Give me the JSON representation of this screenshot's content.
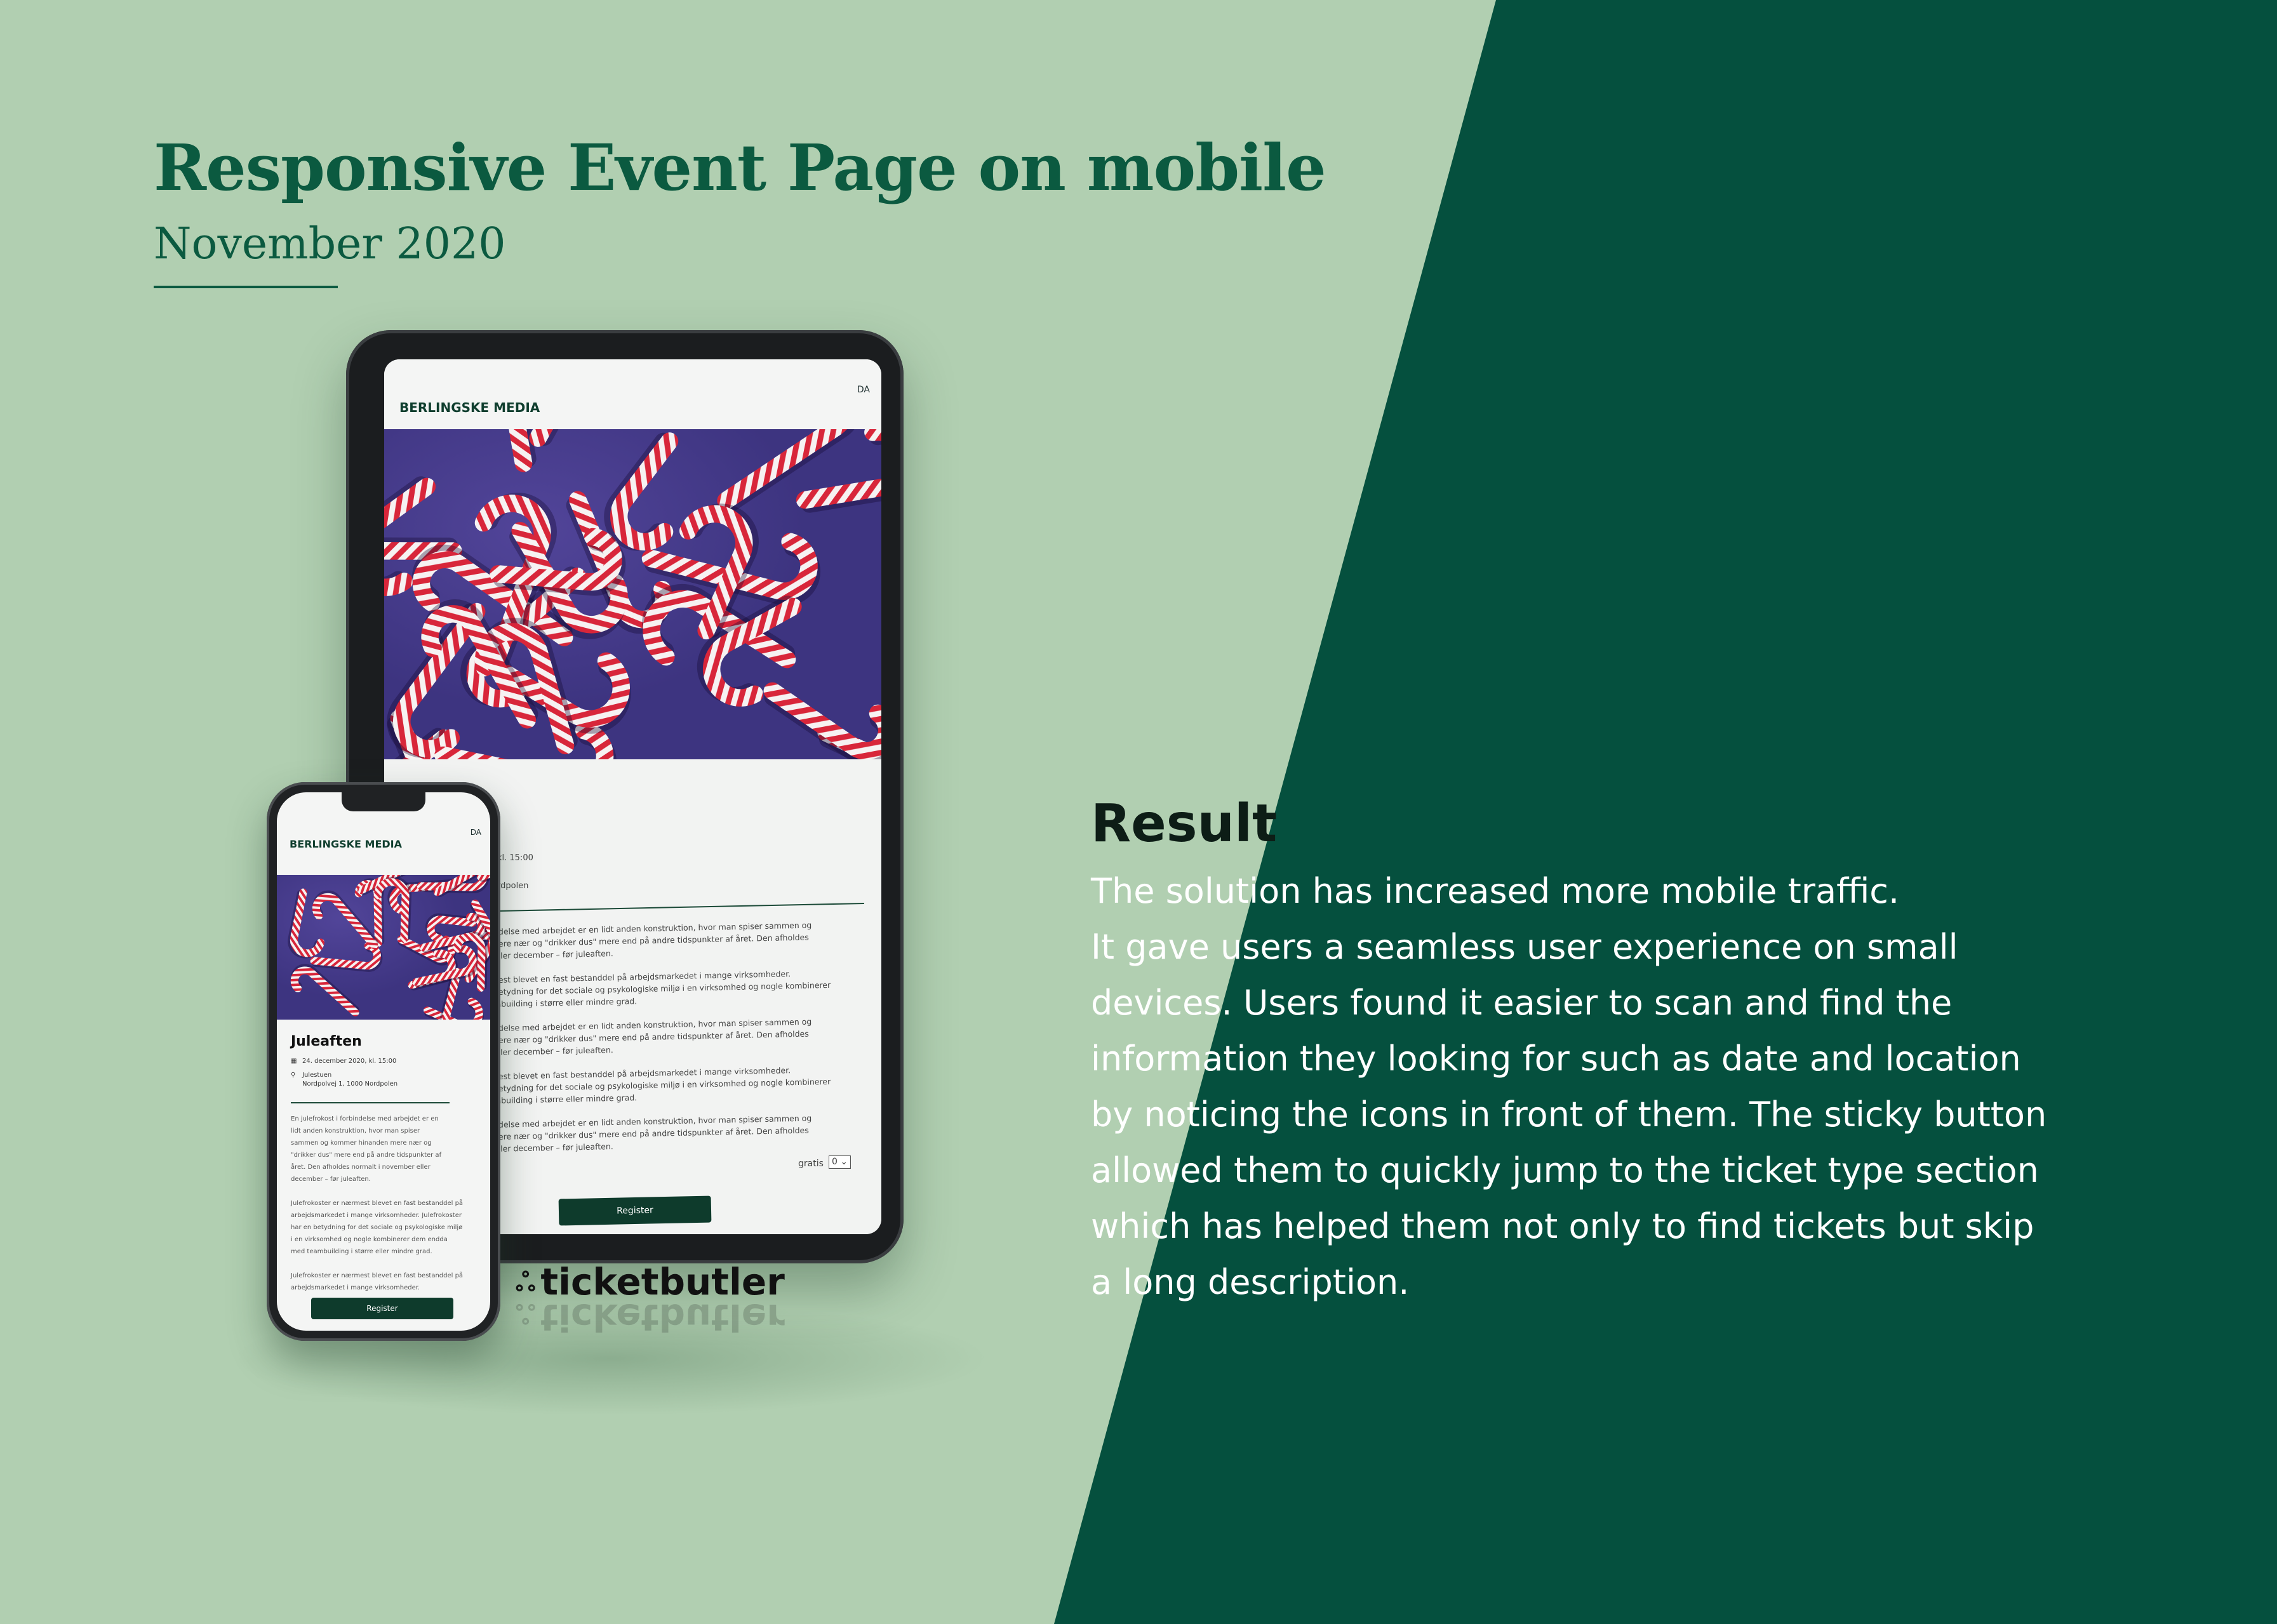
{
  "header": {
    "title": "Responsive Event Page on mobile",
    "date": "November 2020"
  },
  "result": {
    "heading": "Result",
    "lines": [
      "The solution has increased more mobile traffic.",
      "It gave users a seamless user experience on small",
      "devices. Users found it easier to scan and find the",
      "information they looking for such as date and location",
      "by noticing the icons in front of them. The sticky button",
      "allowed them to quickly jump to the ticket type section",
      "which has helped them not only to find tickets but skip",
      "a long description."
    ]
  },
  "tablet": {
    "brand": "BERLINGSKE MEDIA",
    "lang": "DA",
    "time_fragment": "kl. 15:00",
    "location_fragment": "rdpolen",
    "body_lines": [
      "ndelse med arbejdet er en lidt anden konstruktion, hvor man spiser sammen og",
      "nere nær og \"drikker dus\" mere end på andre tidspunkter af året. Den afholdes",
      "eller december – før juleaften.",
      "",
      "nest blevet en fast bestanddel på arbejdsmarkedet i mange virksomheder.",
      "betydning for det sociale og psykologiske miljø i en virksomhed og nogle kombinerer",
      "mbuilding i større eller mindre grad.",
      "",
      "ndelse med arbejdet er en lidt anden konstruktion, hvor man spiser sammen og",
      "nere nær og \"drikker dus\" mere end på andre tidspunkter af året. Den afholdes",
      "eller december – før juleaften.",
      "",
      "nest blevet en fast bestanddel på arbejdsmarkedet i mange virksomheder.",
      "betydning for det sociale og psykologiske miljø i en virksomhed og nogle kombinerer",
      "mbuilding i større eller mindre grad.",
      "",
      "ndelse med arbejdet er en lidt anden konstruktion, hvor man spiser sammen og",
      "nere nær og \"drikker dus\" mere end på andre tidspunkter af året. Den afholdes",
      "eller december – før juleaften."
    ],
    "ticket_label": "gratis",
    "ticket_qty": "0",
    "register": "Register"
  },
  "phone": {
    "brand": "BERLINGSKE MEDIA",
    "lang": "DA",
    "event_title": "Juleaften",
    "date": "24. december 2020, kl. 15:00",
    "venue": "Julestuen",
    "address": "Nordpolvej 1, 1000 Nordpolen",
    "body_lines": [
      "En julefrokost i forbindelse med arbejdet er en",
      "lidt anden konstruktion, hvor man spiser",
      "sammen og kommer hinanden mere nær og",
      "\"drikker dus\" mere end på andre tidspunkter af",
      "året. Den afholdes normalt i november eller",
      "december – før juleaften.",
      "",
      "Julefrokoster er nærmest blevet en fast bestanddel på",
      "arbejdsmarkedet i mange virksomheder. Julefrokoster",
      "har en betydning for det sociale og psykologiske miljø",
      "i en virksomhed og nogle kombinerer dem endda",
      "med teambuilding i større eller mindre grad.",
      "",
      "Julefrokoster er nærmest blevet en fast bestanddel på",
      "arbejdsmarkedet i mange virksomheder."
    ],
    "register": "Register"
  },
  "ticketbutler": {
    "name": "ticketbutler",
    "icon": "mustache-icon"
  },
  "colors": {
    "light_green": "#b1cfb1",
    "dark_green": "#05503e",
    "title_green": "#0b5a40",
    "button_green": "#0e3b2c"
  }
}
